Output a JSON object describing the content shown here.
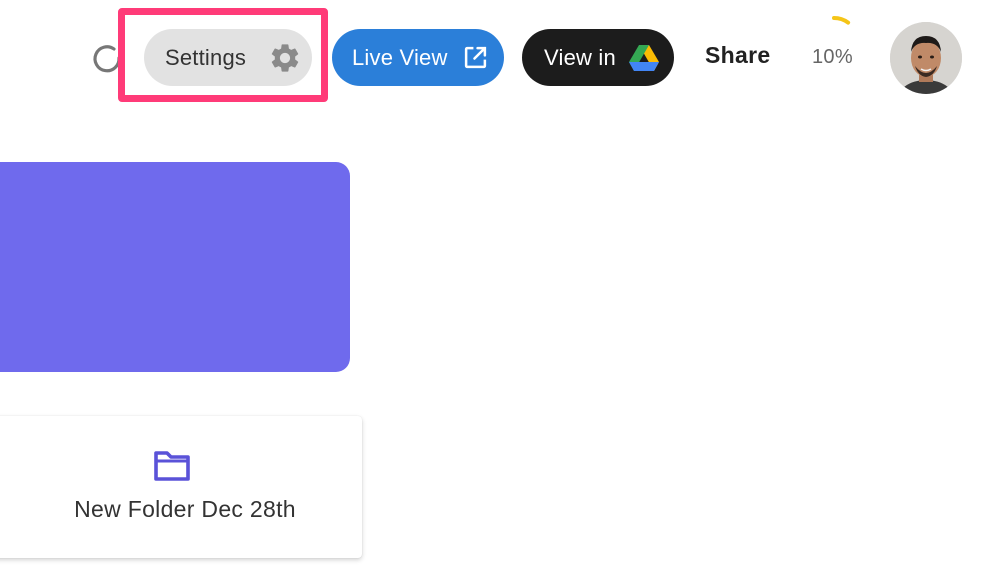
{
  "toolbar": {
    "refresh_icon": "refresh-icon",
    "settings": {
      "label": "Settings",
      "icon": "gear-icon"
    },
    "live_view": {
      "label": "Live View",
      "icon": "external-link-icon"
    },
    "view_in": {
      "label": "View in",
      "icon": "google-drive-icon"
    },
    "share": {
      "label": "Share"
    },
    "progress": {
      "text": "10%",
      "value": 0.1,
      "color": "#f5c518"
    },
    "avatar": {
      "icon": "user-avatar"
    }
  },
  "highlight": {
    "target": "settings-button",
    "color": "#ff3b78"
  },
  "banner": {
    "color": "#6f6aed"
  },
  "folders": [
    {
      "name": "New Folder Dec 28th",
      "icon": "folder-icon",
      "color": "#5a52d8"
    }
  ],
  "colors": {
    "live_view_bg": "#2b7fd9",
    "view_in_bg": "#1c1c1c",
    "settings_bg": "#e2e2e2"
  }
}
